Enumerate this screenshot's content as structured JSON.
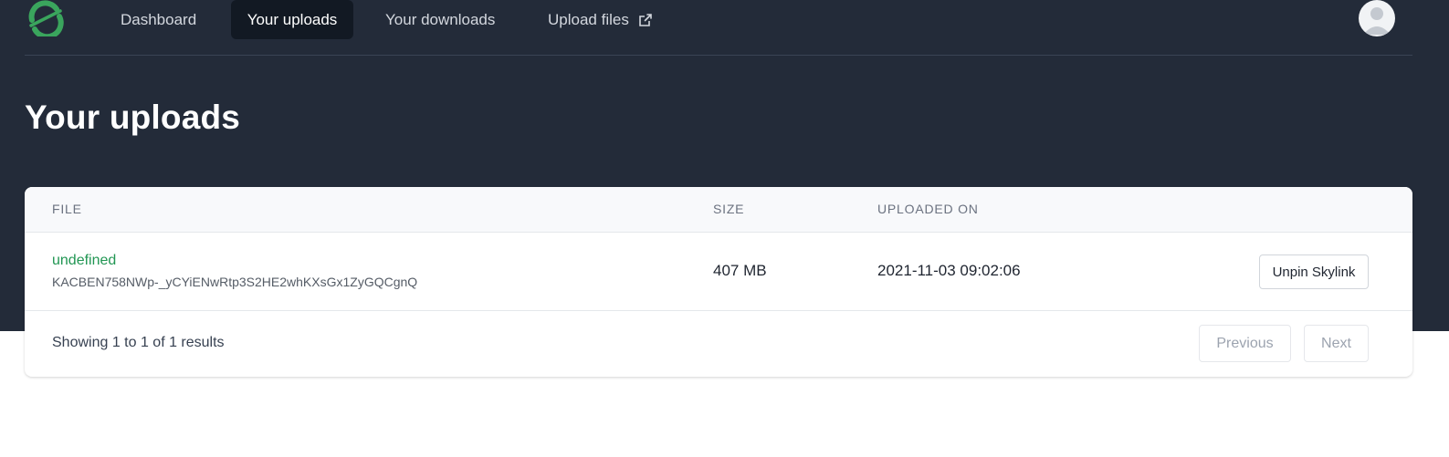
{
  "nav": {
    "logo_icon": "skynet-logo-icon",
    "items": [
      {
        "label": "Dashboard",
        "active": false
      },
      {
        "label": "Your uploads",
        "active": true
      },
      {
        "label": "Your downloads",
        "active": false
      },
      {
        "label": "Upload files",
        "active": false,
        "icon": "external-link-icon"
      }
    ],
    "avatar_icon": "user-avatar-icon"
  },
  "page": {
    "title": "Your uploads"
  },
  "table": {
    "headers": {
      "file": "FILE",
      "size": "SIZE",
      "uploaded_on": "UPLOADED ON"
    },
    "rows": [
      {
        "name": "undefined",
        "skylink": "KACBEN758NWp-_yCYiENwRtp3S2HE2whKXsGx1ZyGQCgnQ",
        "size": "407 MB",
        "uploaded_on": "2021-11-03 09:02:06",
        "action": "Unpin Skylink"
      }
    ],
    "summary": "Showing 1 to 1 of 1 results",
    "pagination": {
      "previous": "Previous",
      "next": "Next"
    }
  },
  "colors": {
    "header_bg": "#232b39",
    "accent_green": "#219653",
    "active_tab_bg": "#121923"
  }
}
